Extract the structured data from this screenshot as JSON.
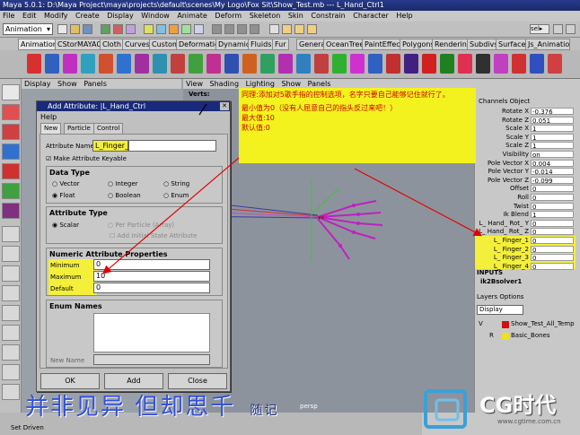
{
  "window": {
    "title": "Maya 5.0.1: D:\\Maya Project\\maya\\projects\\default\\scenes\\My Logo\\Fox Sit\\Show_Test.mb  ---  L_Hand_Ctrl1"
  },
  "menubar": [
    "File",
    "Edit",
    "Modify",
    "Create",
    "Display",
    "Window",
    "Animate",
    "Deform",
    "Skeleton",
    "Skin",
    "Constrain",
    "Character",
    "Help"
  ],
  "status": {
    "mode": "Animation",
    "sel_label": "sel▸"
  },
  "shelf_tabs": [
    "Animation",
    "CStorMAYA09",
    "Cloth",
    "Curves",
    "Custom",
    "Deformation",
    "Dynamics",
    "Fluids",
    "Fur",
    "General",
    "OceanTree",
    "PaintEffects",
    "Polygons",
    "Rendering",
    "Subdivs",
    "Surfaces",
    "Js_Animation"
  ],
  "left_panel_menu": [
    "Display",
    "Show",
    "Panels"
  ],
  "viewport_menu": [
    "View",
    "Shading",
    "Lighting",
    "Show",
    "Panels"
  ],
  "viewport": {
    "verts_label": "Verts:",
    "camera": "persp"
  },
  "dialog": {
    "title": "Add Attribute: |L_Hand_Ctrl",
    "menu": "Help",
    "tabs": [
      "New",
      "Particle",
      "Control"
    ],
    "attribute_name_label": "Attribute Name",
    "attribute_name_value": "L_Finger_5",
    "keyable_label": "Make Attribute Keyable",
    "data_type_title": "Data Type",
    "data_types": [
      "Vector",
      "Integer",
      "String",
      "Float",
      "Boolean",
      "Enum"
    ],
    "attribute_type_title": "Attribute Type",
    "attr_scalar": "Scalar",
    "attr_per_particle": "Per Particle (Array)",
    "attr_initial": "Add Initial State Attribute",
    "numeric_title": "Numeric Attribute Properties",
    "min_label": "Minimum",
    "min_value": "0",
    "max_label": "Maximum",
    "max_value": "10",
    "default_label": "Default",
    "default_value": "0",
    "enum_title": "Enum Names",
    "new_name_label": "New Name",
    "buttons": {
      "ok": "OK",
      "add": "Add",
      "close": "Close"
    }
  },
  "note": {
    "line1": "同理:添加对5歌手指的控制选项，名字只要自己能够记住就行了。",
    "line2": "最小值为0（没有人屈意自己的指头反过来吧！）",
    "line3": "最大值:10",
    "line4": "默认值:0"
  },
  "channel_box": {
    "header": "Channels  Object",
    "channels": [
      {
        "name": "Rotate X",
        "value": "-0.376"
      },
      {
        "name": "Rotate Z",
        "value": "0.051"
      },
      {
        "name": "Scale X",
        "value": "1"
      },
      {
        "name": "Scale Y",
        "value": "1"
      },
      {
        "name": "Scale Z",
        "value": "1"
      },
      {
        "name": "Visibility",
        "value": "on"
      },
      {
        "name": "Pole Vector X",
        "value": "0.004"
      },
      {
        "name": "Pole Vector Y",
        "value": "-0.014"
      },
      {
        "name": "Pole Vector Z",
        "value": "-0.099"
      },
      {
        "name": "Offset",
        "value": "0"
      },
      {
        "name": "Roll",
        "value": "0"
      },
      {
        "name": "Twist",
        "value": "0"
      },
      {
        "name": "Ik Blend",
        "value": "1"
      },
      {
        "name": "L_ Hand_ Rot_ Y",
        "value": "0"
      },
      {
        "name": "L_ Hand_ Rot_ Z",
        "value": "0"
      },
      {
        "name": "L_ Finger_1",
        "value": "0"
      },
      {
        "name": "L_ Finger_2",
        "value": "0"
      },
      {
        "name": "L_ Finger_3",
        "value": "0"
      },
      {
        "name": "L_ Finger_4",
        "value": "0"
      }
    ],
    "inputs_label": "INPUTS",
    "inputs_item": "ik2Bsolver1"
  },
  "layers": {
    "header": "Layers  Options",
    "display_select": "Display",
    "rows": [
      {
        "flag": "V",
        "name": "Show_Test_All_Temp",
        "color": "#d01010"
      },
      {
        "flag": "R",
        "name": "Basic_Bones",
        "color": "#f0e020"
      }
    ]
  },
  "watermark": {
    "text": "并非见异 但却思千",
    "signature": "随记"
  },
  "logo": {
    "text": "CG时代",
    "url": "www.cgtime.com.cn"
  },
  "bottom": {
    "script_label": "Set Driven"
  },
  "colors": {
    "note_bg": "#f4f21e",
    "highlight": "#f4ef3a",
    "arrow": "#e00000",
    "accent": "#1a2a7a"
  }
}
